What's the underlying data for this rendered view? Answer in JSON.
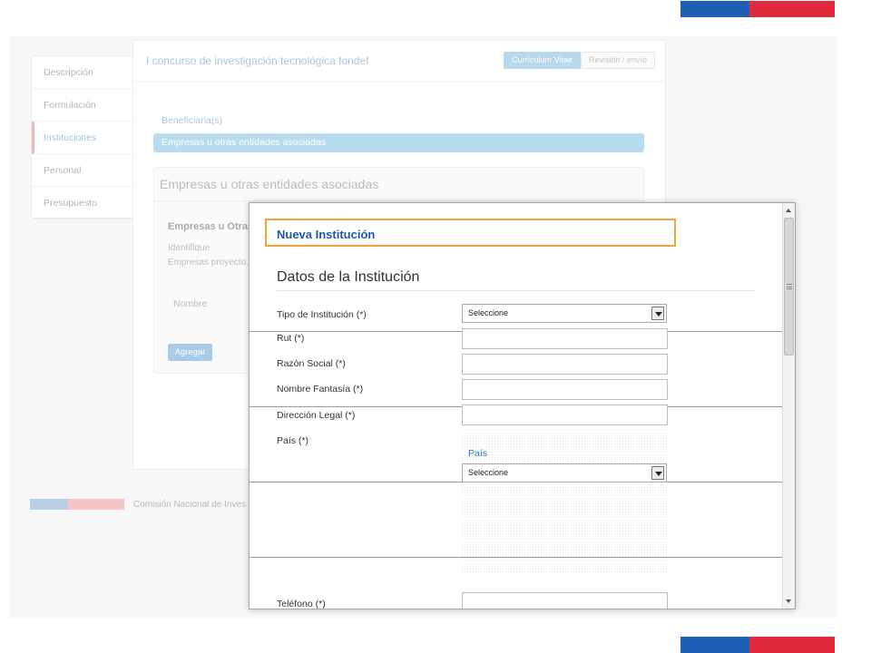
{
  "page": {
    "title": "I concurso de investigación tecnológica fondef",
    "steps": [
      "Currículum Vitae",
      "Revisión / envío"
    ]
  },
  "sidebar": {
    "items": [
      {
        "label": "Descripción"
      },
      {
        "label": "Formulación"
      },
      {
        "label": "Instituciones"
      },
      {
        "label": "Personal"
      },
      {
        "label": "Presupuesto"
      }
    ]
  },
  "content": {
    "breadcrumb": "Beneficiaria(s)",
    "active_bar": "Empresas u otras entidades asociadas",
    "section_title": "Empresas u otras entidades asociadas",
    "subsection_title": "Empresas u Otras",
    "subsection_desc": "Identifique Empresas proyecto.",
    "column_name": "Nombre",
    "add_button": "Agregar"
  },
  "footer": {
    "text": "Comisión Nacional de Inves"
  },
  "modal": {
    "title": "Nueva Institución",
    "form_heading": "Datos de la Institución",
    "fields": {
      "tipo": {
        "label": "Tipo de Institución (*)",
        "value": "Seleccione"
      },
      "rut": {
        "label": "Rut (*)",
        "value": ""
      },
      "razon": {
        "label": "Razón Social (*)",
        "value": ""
      },
      "fantasia": {
        "label": "Nombre Fantasía (*)",
        "value": ""
      },
      "direccion": {
        "label": "Dirección Legal (*)",
        "value": ""
      },
      "pais": {
        "label": "País (*)",
        "link": "País",
        "value": "Seleccione"
      },
      "telefono": {
        "label": "Teléfono (*)",
        "value": ""
      }
    }
  },
  "colors": {
    "flag_blue": "#1f5fb5",
    "flag_red": "#e0293b",
    "modal_title": "#1d58a8",
    "highlight_border": "#f0a43c"
  }
}
